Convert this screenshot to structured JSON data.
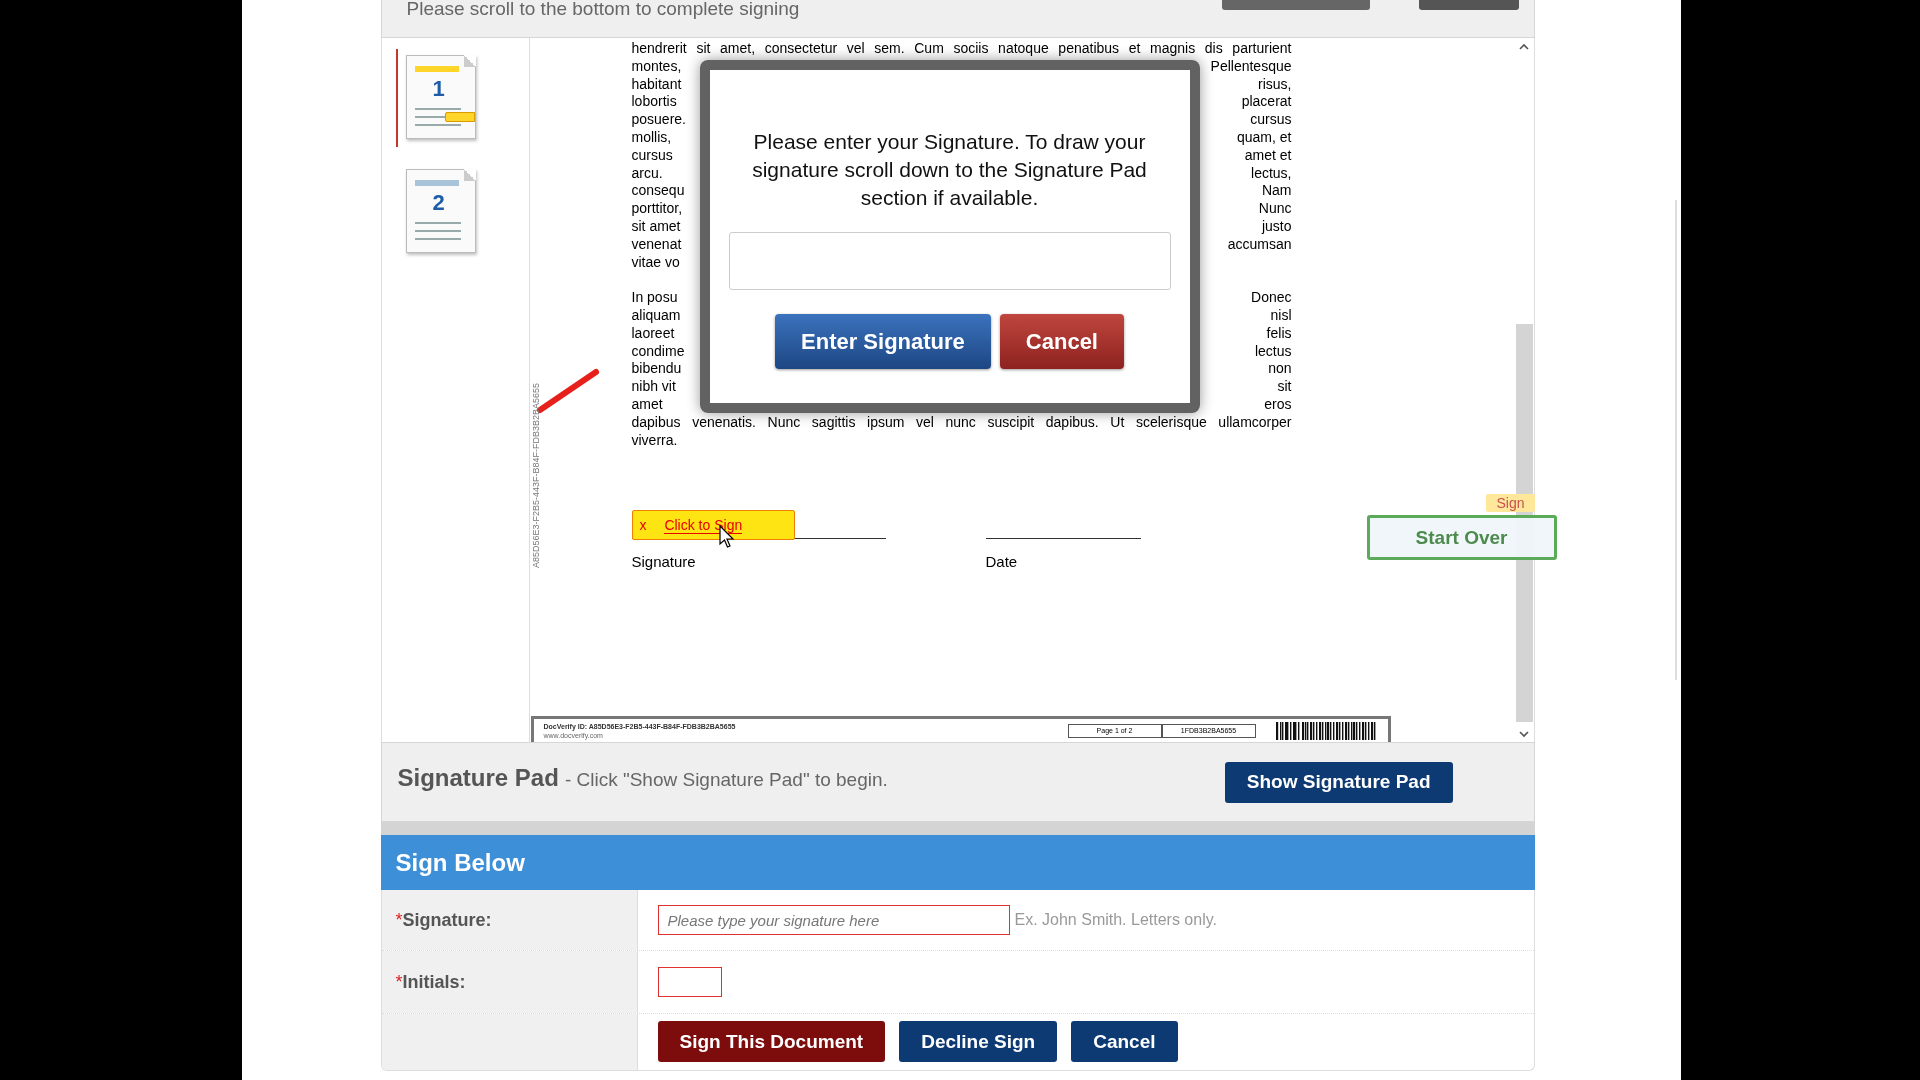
{
  "header": {
    "instruction": "Please scroll to the bottom to complete signing"
  },
  "thumbnails": [
    {
      "label": "1",
      "selected": true
    },
    {
      "label": "2",
      "selected": false
    }
  ],
  "document": {
    "side_code": "A85D56E3-F2B5-443F-B84F-FDB3B2BA5655",
    "lines": [
      {
        "kind": "full",
        "text": "hendrerit sit amet, consectetur vel sem. Cum sociis natoque penatibus et magnis dis parturient"
      },
      {
        "kind": "split",
        "left": "montes,",
        "right": "Pellentesque"
      },
      {
        "kind": "split",
        "left": "habitant",
        "right": "risus,"
      },
      {
        "kind": "split",
        "left": "lobortis",
        "right": "placerat"
      },
      {
        "kind": "split",
        "left": "posuere.",
        "right": "cursus"
      },
      {
        "kind": "split",
        "left": "mollis,",
        "right": "quam, et"
      },
      {
        "kind": "split",
        "left": "cursus",
        "right": "amet et"
      },
      {
        "kind": "split",
        "left": "arcu.",
        "right": "lectus,"
      },
      {
        "kind": "split",
        "left": "consequ",
        "right": "Nam"
      },
      {
        "kind": "split",
        "left": "porttitor,",
        "right": "Nunc"
      },
      {
        "kind": "split",
        "left": "sit amet",
        "right": "justo"
      },
      {
        "kind": "split",
        "left": "venenat",
        "right": "accumsan"
      },
      {
        "kind": "split",
        "left": "vitae vo"
      },
      {
        "kind": "gap"
      },
      {
        "kind": "split",
        "left": "In posu",
        "right": "Donec"
      },
      {
        "kind": "split",
        "left": "aliquam",
        "right": "nisl"
      },
      {
        "kind": "split",
        "left": "laoreet",
        "right": "felis"
      },
      {
        "kind": "split",
        "left": "condime",
        "right": "lectus"
      },
      {
        "kind": "split",
        "left": "bibendu",
        "right": "non"
      },
      {
        "kind": "split",
        "left": "nibh vit",
        "right": "sit"
      },
      {
        "kind": "split",
        "left": "amet",
        "right": "eros"
      },
      {
        "kind": "full",
        "text": "dapibus venenatis. Nunc sagittis ipsum vel nunc suscipit dapibus. Ut scelerisque ullamcorper"
      },
      {
        "kind": "last",
        "text": "viverra."
      }
    ],
    "sign_tag": {
      "marker": "x",
      "label": "Click to Sign"
    },
    "fields": [
      {
        "label": "Signature"
      },
      {
        "label": "Date"
      }
    ],
    "footer": {
      "docverify_id": "DocVerify ID: A85D56E3-F2B5-443F-B84F-FDB3B2BA5655",
      "site": "www.docverify.com",
      "page": "Page 1 of 2",
      "code": "1FDB3B2BA5655"
    }
  },
  "floating": {
    "tag": "Sign",
    "button": "Start Over"
  },
  "modal": {
    "message": "Please enter your Signature. To draw your signature scroll down to the Signature Pad section if available.",
    "buttons": [
      {
        "label": "Enter Signature",
        "kind": "primary"
      },
      {
        "label": "Cancel",
        "kind": "danger"
      }
    ]
  },
  "signature_pad": {
    "title": "Signature Pad",
    "hint": "- Click \"Show Signature Pad\" to begin.",
    "button": "Show Signature Pad"
  },
  "sign_below": {
    "title": "Sign Below",
    "rows": [
      {
        "kind": "text",
        "required_mark": "*",
        "label": "Signature:",
        "placeholder": "Please type your signature here",
        "hint": "Ex. John Smith. Letters only."
      },
      {
        "kind": "initials",
        "required_mark": "*",
        "label": "Initials:"
      }
    ],
    "buttons": [
      {
        "label": "Sign This Document",
        "kind": "danger"
      },
      {
        "label": "Decline Sign",
        "kind": "primary"
      },
      {
        "label": "Cancel",
        "kind": "primary"
      }
    ]
  }
}
